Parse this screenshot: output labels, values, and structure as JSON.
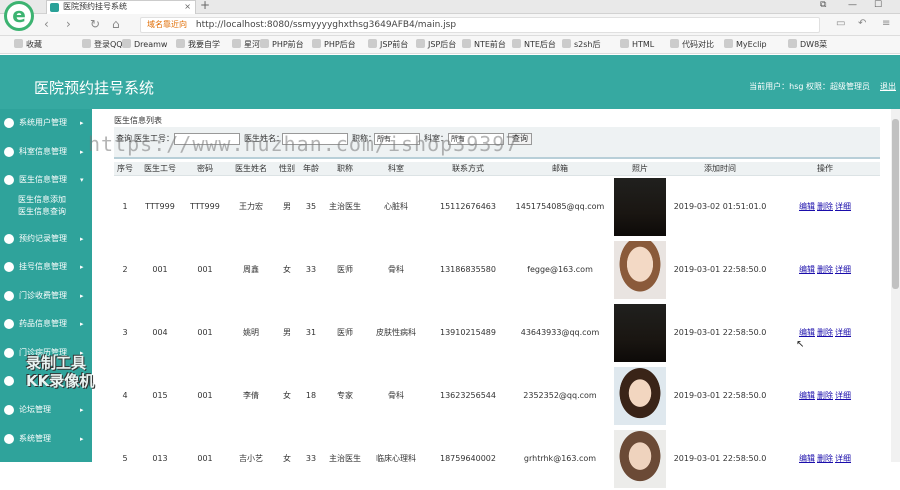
{
  "browser": {
    "tab_title": "医院预约挂号系统",
    "new_tab": "+",
    "address_tip": "域名靠近向",
    "url": "http://localhost:8080/ssmyyyyghxthsg3649AFB4/main.jsp",
    "bookmarks": [
      "收藏",
      "登录QQ",
      "Dreamw",
      "我要自学",
      "星河",
      "PHP前台",
      "PHP后台",
      "JSP前台",
      "JSP后台",
      "NTE前台",
      "NTE后台",
      "s2sh后",
      "HTML",
      "代码对比",
      "MyEclip",
      "DW8菜"
    ]
  },
  "header": {
    "title": "医院预约挂号系统",
    "user_info": "当前用户：hsg  权限：超级管理员",
    "logout": "退出"
  },
  "sidebar": {
    "items": [
      {
        "label": "系统用户管理",
        "arrow": "▸"
      },
      {
        "label": "科室信息管理",
        "arrow": "▸"
      },
      {
        "label": "医生信息管理",
        "arrow": "▾"
      },
      {
        "label": "预约记录管理",
        "arrow": "▸"
      },
      {
        "label": "挂号信息管理",
        "arrow": "▸"
      },
      {
        "label": "门诊收费管理",
        "arrow": "▸"
      },
      {
        "label": "药品信息管理",
        "arrow": "▸"
      },
      {
        "label": "门诊病历管理",
        "arrow": "▸"
      },
      {
        "label": "",
        "arrow": "▸"
      },
      {
        "label": "论坛管理",
        "arrow": "▸"
      },
      {
        "label": "系统管理",
        "arrow": "▸"
      }
    ],
    "subitems": [
      "医生信息添加",
      "医生信息查询"
    ]
  },
  "content": {
    "breadcrumb": "医生信息列表",
    "search": {
      "label_query": "查询",
      "label_code": "医生工号：",
      "label_name": "医生姓名：",
      "label_title": "职称：",
      "title_option": "所有",
      "label_dept": "科室：",
      "dept_option": "所有",
      "button": "查询"
    },
    "columns": [
      "序号",
      "医生工号",
      "密码",
      "医生姓名",
      "性别",
      "年龄",
      "职称",
      "科室",
      "联系方式",
      "邮箱",
      "照片",
      "添加时间",
      "操作"
    ],
    "rows": [
      {
        "no": "1",
        "code": "TTT999",
        "pwd": "TTT999",
        "name": "王力宏",
        "gender": "男",
        "age": "35",
        "title": "主治医生",
        "dept": "心脏科",
        "phone": "15112676463",
        "email": "1451754085@qq.com",
        "time": "2019-03-02 01:51:01.0",
        "photo": "ph-a"
      },
      {
        "no": "2",
        "code": "001",
        "pwd": "001",
        "name": "周鑫",
        "gender": "女",
        "age": "33",
        "title": "医师",
        "dept": "骨科",
        "phone": "13186835580",
        "email": "fegge@163.com",
        "time": "2019-03-01 22:58:50.0",
        "photo": "ph-b"
      },
      {
        "no": "3",
        "code": "004",
        "pwd": "001",
        "name": "姚明",
        "gender": "男",
        "age": "31",
        "title": "医师",
        "dept": "皮肤性病科",
        "phone": "13910215489",
        "email": "43643933@qq.com",
        "time": "2019-03-01 22:58:50.0",
        "photo": "ph-a"
      },
      {
        "no": "4",
        "code": "015",
        "pwd": "001",
        "name": "李倩",
        "gender": "女",
        "age": "18",
        "title": "专家",
        "dept": "骨科",
        "phone": "13623256544",
        "email": "2352352@qq.com",
        "time": "2019-03-01 22:58:50.0",
        "photo": "ph-c"
      },
      {
        "no": "5",
        "code": "013",
        "pwd": "001",
        "name": "吉小艺",
        "gender": "女",
        "age": "33",
        "title": "主治医生",
        "dept": "临床心理科",
        "phone": "18759640002",
        "email": "grhtrhk@163.com",
        "time": "2019-03-01 22:58:50.0",
        "photo": "ph-d"
      }
    ],
    "ops": {
      "edit": "编辑",
      "delete": "删除",
      "detail": "详细"
    }
  },
  "overlay": {
    "watermark": "https://www.huzhan.com/ishop39397",
    "recorder_line1": "录制工具",
    "recorder_line2": "KK录像机"
  }
}
